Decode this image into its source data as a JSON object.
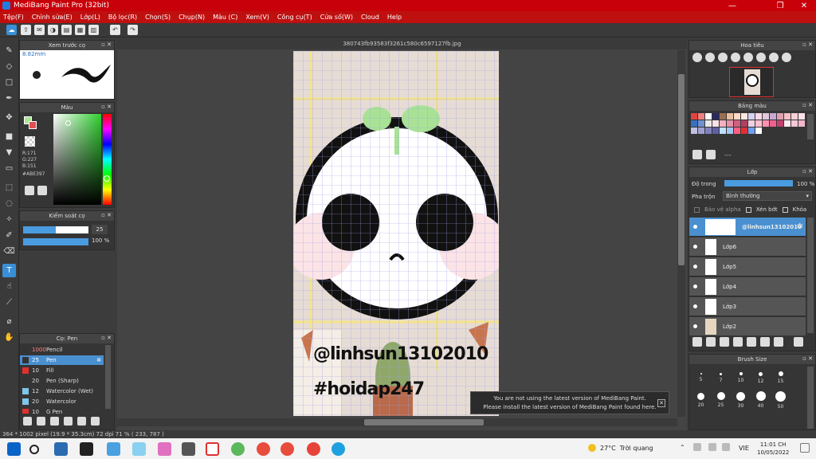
{
  "window": {
    "title": "MediBang Paint Pro (32bit)",
    "minimize": "—",
    "restore": "❐",
    "close": "✕"
  },
  "menu": [
    "Tệp(F)",
    "Chỉnh sửa(E)",
    "Lớp(L)",
    "Bộ lọc(R)",
    "Chọn(S)",
    "Chụp(N)",
    "Màu (C)",
    "Xem(V)",
    "Công cụ(T)",
    "Cửa số(W)",
    "Cloud",
    "Help"
  ],
  "document_tab": "380743fb93583f3261c580c6597127fb.jpg",
  "brush_preview": {
    "title": "Xem trước cọ",
    "size_label": "8.82mm"
  },
  "color_panel": {
    "title": "Màu",
    "r": "R:171",
    "g": "G:227",
    "b": "B:151",
    "hex": "#ABE397"
  },
  "brush_control": {
    "title": "Kiểm soát cọ",
    "size": "25",
    "opacity": "100 %"
  },
  "brush_list": {
    "title": "Cọ: Pen",
    "items": [
      {
        "size": "1000",
        "name": "Pencil",
        "color": "#333333"
      },
      {
        "size": "25",
        "name": "Pen",
        "color": "#333333"
      },
      {
        "size": "10",
        "name": "Fill",
        "color": "#e03030"
      },
      {
        "size": "20",
        "name": "Pen (Sharp)",
        "color": "#333333"
      },
      {
        "size": "12",
        "name": "Watercolor (Wet)",
        "color": "#7fc7e8"
      },
      {
        "size": "20",
        "name": "Watercolor",
        "color": "#7fc7e8"
      },
      {
        "size": "10",
        "name": "G Pen",
        "color": "#e03030"
      }
    ]
  },
  "navigator": {
    "title": "Hoa tiêu"
  },
  "palette": {
    "title": "Bảng màu",
    "label": "---",
    "colors": [
      "#e0443c",
      "#f08080",
      "#ffffff",
      "#2a2a60",
      "#9a7050",
      "#e8c0a0",
      "#ffd8c8",
      "#ffe8e0",
      "#d8d0f0",
      "#f8d8e8",
      "#e0c8d8",
      "#c8a8d0",
      "#e0a0b0",
      "#f4c0c8",
      "#f8d0d8",
      "#ffe0e8",
      "#3a70c0",
      "#7090d0",
      "#e8e8e8",
      "#fce0e8",
      "#f0b0c0",
      "#e890a8",
      "#d06080",
      "#b04060",
      "#f0d0e0",
      "#ffc0d0",
      "#ff90b0",
      "#f06090",
      "#c04070",
      "#ffe8f0",
      "#f8c8d8",
      "#f0b8c8",
      "#c0c0e0",
      "#a0a0d0",
      "#8080c0",
      "#6060a0",
      "#c0e0ff",
      "#a0c8f0",
      "#ff6080",
      "#e03030",
      "#70a0f0",
      "#ffffff"
    ]
  },
  "layer_panel": {
    "title": "Lớp",
    "opacity_label": "Độ trong",
    "opacity_value": "100 %",
    "blend_label": "Pha trộn",
    "blend_value": "Bình thường",
    "protect_alpha": "Bảo vệ alpha",
    "clipping": "Xén bớt",
    "lock": "Khóa",
    "layers": [
      "@linhsun13102010",
      "Lớp6",
      "Lớp5",
      "Lớp4",
      "Lớp3",
      "Lớp2"
    ]
  },
  "brush_size": {
    "title": "Brush Size",
    "sizes": [
      "5",
      "7",
      "10",
      "12",
      "15",
      "20",
      "25",
      "30",
      "40",
      "50"
    ]
  },
  "artwork": {
    "handle": "@linhsun13102010",
    "hashtag": "#hoidap247"
  },
  "notice": {
    "line1": "You are not using the latest version of MediBang Paint.",
    "line2": "Please install the latest version of MediBang Paint found here.",
    "close": "✕"
  },
  "status": {
    "text": "364 * 1002 pixel  (19.9 * 35.3cm)  72 dpi  71 %  ( 233, 787 )"
  },
  "taskbar": {
    "weather_temp": "27°C",
    "weather_desc": "Trời quang",
    "lang": "VIE",
    "time": "11:01 CH",
    "date": "10/05/2022"
  },
  "colors": {
    "titlebar": "#c8000a",
    "accent": "#3a8fd6",
    "selected_color": "#ABE397"
  }
}
